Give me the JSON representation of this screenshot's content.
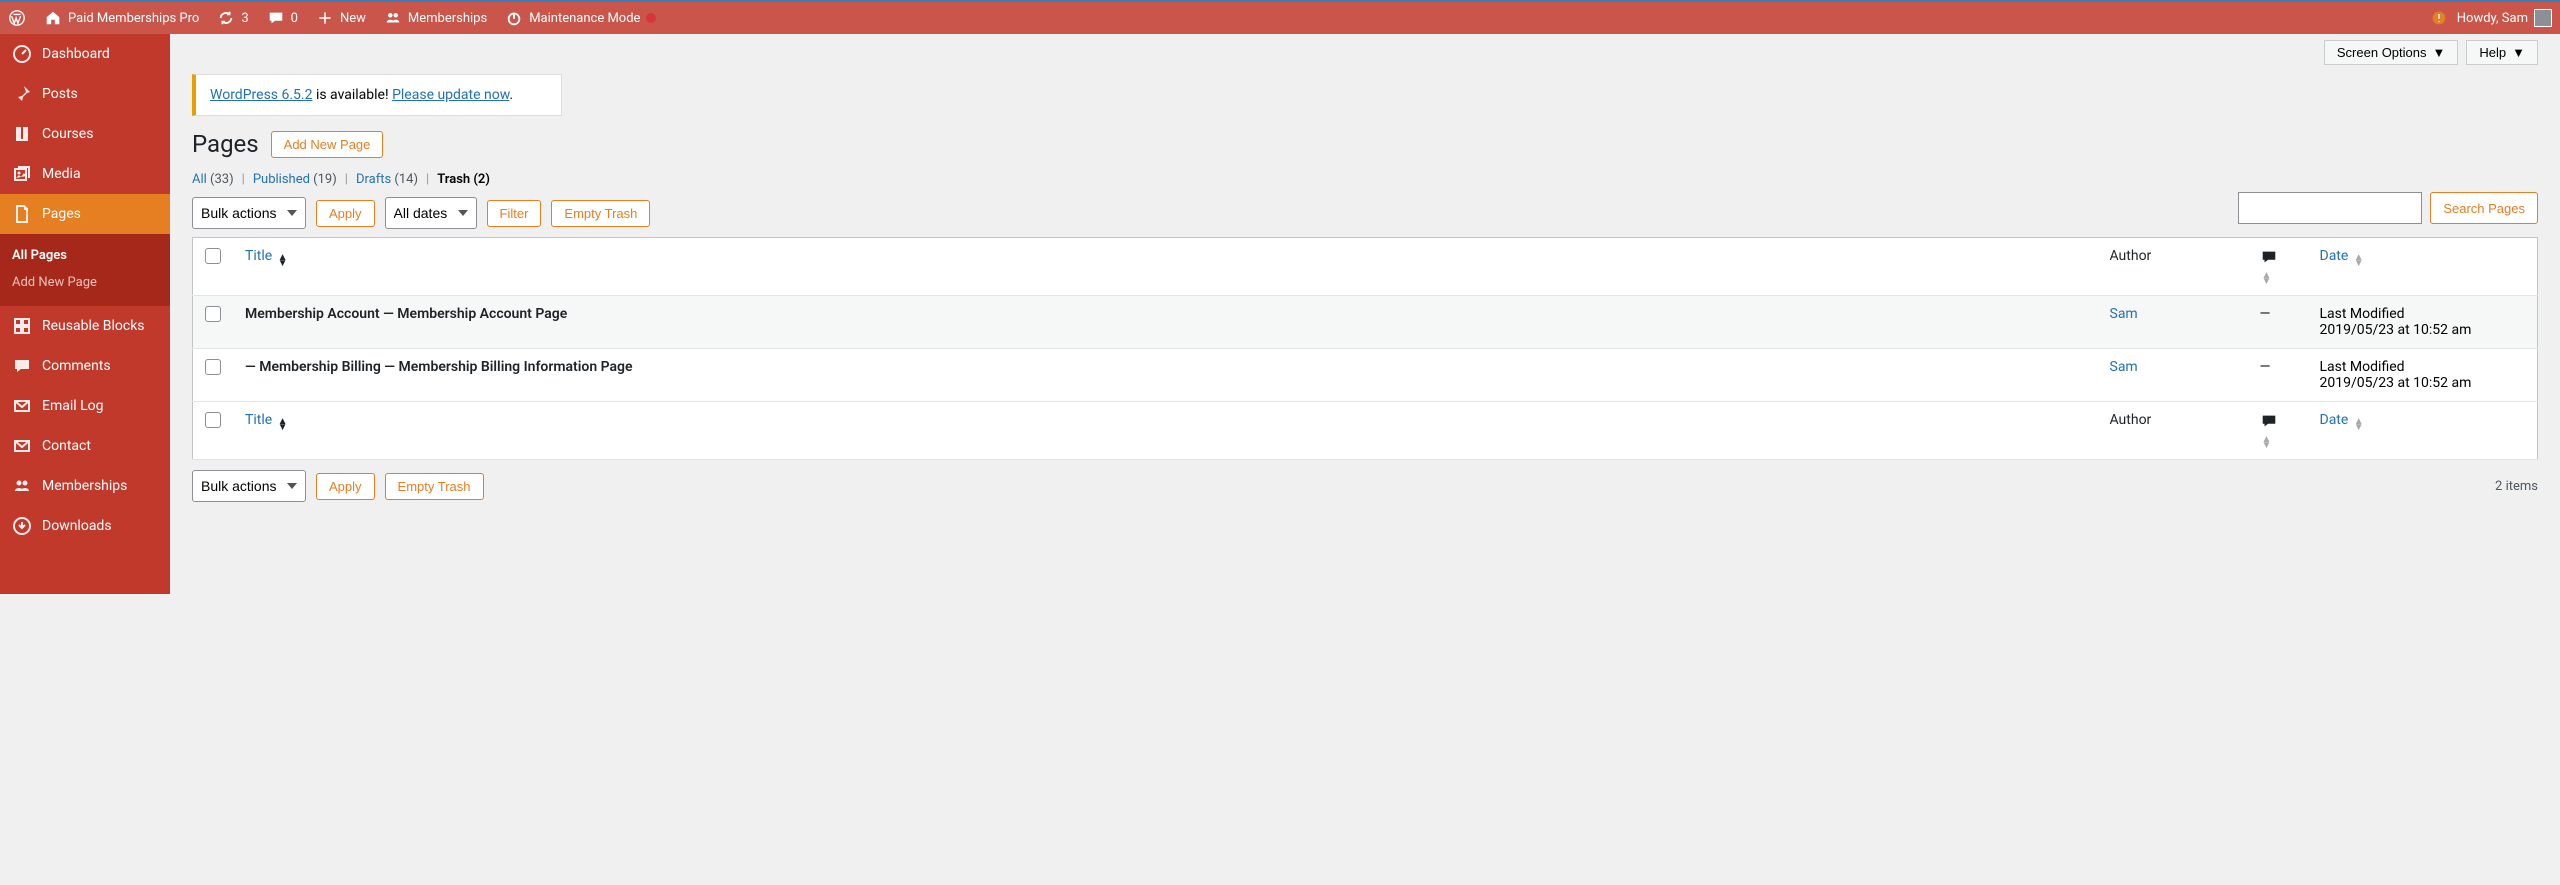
{
  "adminbar": {
    "site_name": "Paid Memberships Pro",
    "updates": "3",
    "comments": "0",
    "new": "New",
    "memberships": "Memberships",
    "maintenance": "Maintenance Mode",
    "howdy": "Howdy, Sam"
  },
  "sidebar": {
    "dashboard": "Dashboard",
    "posts": "Posts",
    "courses": "Courses",
    "media": "Media",
    "pages": "Pages",
    "all_pages": "All Pages",
    "add_new_page": "Add New Page",
    "reusable": "Reusable Blocks",
    "comments": "Comments",
    "email_log": "Email Log",
    "contact": "Contact",
    "memberships": "Memberships",
    "downloads": "Downloads"
  },
  "topright": {
    "screen_options": "Screen Options",
    "help": "Help"
  },
  "notice": {
    "link1": "WordPress 6.5.2",
    "mid": " is available! ",
    "link2": "Please update now",
    "end": "."
  },
  "heading": "Pages",
  "add_new": "Add New Page",
  "filters": {
    "all": "All",
    "all_count": "(33)",
    "published": "Published",
    "published_count": "(19)",
    "drafts": "Drafts",
    "drafts_count": "(14)",
    "trash": "Trash",
    "trash_count": "(2)"
  },
  "controls": {
    "bulk": "Bulk actions",
    "apply": "Apply",
    "all_dates": "All dates",
    "filter": "Filter",
    "empty_trash": "Empty Trash",
    "search": "Search Pages",
    "items": "2 items"
  },
  "columns": {
    "title": "Title",
    "author": "Author",
    "date": "Date"
  },
  "rows": [
    {
      "title": "Membership Account — Membership Account Page",
      "author": "Sam",
      "comments": "—",
      "date_label": "Last Modified",
      "date_val": "2019/05/23 at 10:52 am"
    },
    {
      "title": "— Membership Billing — Membership Billing Information Page",
      "author": "Sam",
      "comments": "—",
      "date_label": "Last Modified",
      "date_val": "2019/05/23 at 10:52 am"
    }
  ]
}
